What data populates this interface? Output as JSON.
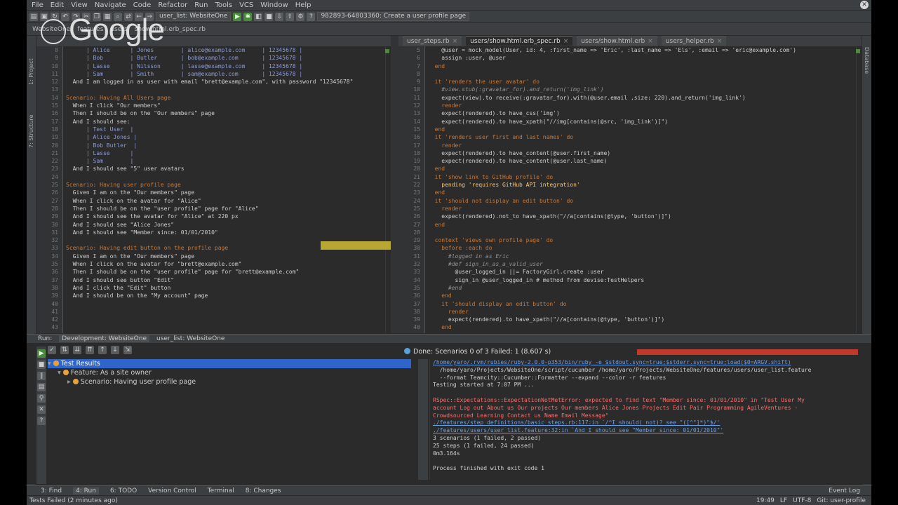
{
  "menu": [
    "File",
    "Edit",
    "View",
    "Navigate",
    "Code",
    "Refactor",
    "Run",
    "Tools",
    "VCS",
    "Window",
    "Help"
  ],
  "toolbar": {
    "run_config": "user_list: WebsiteOne",
    "branch_combo": "982893-64803360: Create a user profile page"
  },
  "navbar": [
    "WebsiteOne",
    "features",
    "users",
    "show.html.erb_spec.rb"
  ],
  "watermark": "Google",
  "left_strip": [
    "1: Project",
    "7: Structure"
  ],
  "right_strip": [
    "Database"
  ],
  "left_editor": {
    "gutter": [
      "8",
      "9",
      "10",
      "11",
      "12",
      "13",
      "14",
      "15",
      "16",
      "17",
      "18",
      "19",
      "20",
      "21",
      "22",
      "23",
      "24",
      "25",
      "26",
      "27",
      "28",
      "29",
      "30",
      "31",
      "32",
      "33",
      "34",
      "35",
      "36",
      "37",
      "38",
      "39",
      "40",
      "41",
      "42",
      "43"
    ],
    "lines": [
      {
        "t": "      | Alice      | Jones        | alice@example.com     | 12345678 |",
        "c": "str"
      },
      {
        "t": "      | Bob        | Butler       | bob@example.com       | 12345678 |",
        "c": "str"
      },
      {
        "t": "      | Lasse      | Nilsson      | lasse@example.com     | 12345678 |",
        "c": "str"
      },
      {
        "t": "      | Sam        | Smith        | sam@example.com       | 12345678 |",
        "c": "str"
      },
      {
        "t": "  And I am logged in as user with email \"brett@example.com\", with password \"12345678\"",
        "c": ""
      },
      {
        "t": "",
        "c": ""
      },
      {
        "t": "Scenario: Having All Users page",
        "c": "kw"
      },
      {
        "t": "  When I click \"Our members\"",
        "c": ""
      },
      {
        "t": "  Then I should be on the \"Our members\" page",
        "c": ""
      },
      {
        "t": "  And I should see:",
        "c": ""
      },
      {
        "t": "      | Test User  |",
        "c": "str"
      },
      {
        "t": "      | Alice Jones |",
        "c": "str"
      },
      {
        "t": "      | Bob Butler  |",
        "c": "str"
      },
      {
        "t": "      | Lasse      |",
        "c": "str"
      },
      {
        "t": "      | Sam        |",
        "c": "str"
      },
      {
        "t": "  And I should see \"5\" user avatars",
        "c": ""
      },
      {
        "t": "",
        "c": ""
      },
      {
        "t": "Scenario: Having user profile page",
        "c": "kw"
      },
      {
        "t": "  Given I am on the \"Our members\" page",
        "c": ""
      },
      {
        "t": "  When I click on the avatar for \"Alice\"",
        "c": ""
      },
      {
        "t": "  Then I should be on the \"user profile\" page for \"Alice\"",
        "c": ""
      },
      {
        "t": "  And I should see the avatar for \"Alice\" at 220 px",
        "c": ""
      },
      {
        "t": "  And I should see \"Alice Jones\"",
        "c": ""
      },
      {
        "t": "  And I should see \"Member since: 01/01/2010\"",
        "c": ""
      },
      {
        "t": "",
        "c": ""
      },
      {
        "t": "Scenario: Having edit button on the profile page",
        "c": "kw"
      },
      {
        "t": "  Given I am on the \"Our members\" page",
        "c": ""
      },
      {
        "t": "  When I click on the avatar for \"brett@example.com\"",
        "c": ""
      },
      {
        "t": "  Then I should be on the \"user profile\" page for \"brett@example.com\"",
        "c": ""
      },
      {
        "t": "  And I should see button \"Edit\"",
        "c": ""
      },
      {
        "t": "  And I click the \"Edit\" button",
        "c": ""
      },
      {
        "t": "  And I should be on the \"My account\" page",
        "c": ""
      }
    ]
  },
  "right_editor": {
    "tabs": [
      "user_steps.rb",
      "users/show.html.erb_spec.rb",
      "users/show.html.erb",
      "users_helper.rb"
    ],
    "active_tab": 1,
    "gutter": [
      "5",
      "6",
      "7",
      "8",
      "9",
      "10",
      "11",
      "12",
      "13",
      "14",
      "15",
      "16",
      "17",
      "18",
      "19",
      "20",
      "21",
      "22",
      "23",
      "24",
      "25",
      "26",
      "27",
      "28",
      "29",
      "30",
      "31",
      "32",
      "33",
      "34",
      "35",
      "36",
      "37",
      "38",
      "39",
      "40"
    ],
    "lines": [
      {
        "t": "    @user = mock_model(User, id: 4, :first_name => 'Eric', :last_name => 'Els', :email => 'eric@example.com')",
        "c": ""
      },
      {
        "t": "    assign :user, @user",
        "c": ""
      },
      {
        "t": "  end",
        "c": "kw"
      },
      {
        "t": "",
        "c": ""
      },
      {
        "t": "  it 'renders the user avatar' do",
        "c": "kw"
      },
      {
        "t": "    #view.stub(:gravatar_for).and_return('img_link')",
        "c": "com"
      },
      {
        "t": "    expect(view).to receive(:gravatar_for).with(@user.email ,size: 220).and_return('img_link')",
        "c": ""
      },
      {
        "t": "    render",
        "c": "kw"
      },
      {
        "t": "    expect(rendered).to have_css('img')",
        "c": ""
      },
      {
        "t": "    expect(rendered).to have_xpath(\"//img[contains(@src, 'img_link')]\")",
        "c": ""
      },
      {
        "t": "  end",
        "c": "kw"
      },
      {
        "t": "  it 'renders user first and last names' do",
        "c": "kw"
      },
      {
        "t": "    render",
        "c": "kw"
      },
      {
        "t": "    expect(rendered).to have_content(@user.first_name)",
        "c": ""
      },
      {
        "t": "    expect(rendered).to have_content(@user.last_name)",
        "c": ""
      },
      {
        "t": "  end",
        "c": "kw"
      },
      {
        "t": "  it 'show link to GitHub profile' do",
        "c": "kw"
      },
      {
        "t": "    pending 'requires GitHub API integration'",
        "c": "hl"
      },
      {
        "t": "  end",
        "c": "kw"
      },
      {
        "t": "  it 'should not display an edit button' do",
        "c": "kw"
      },
      {
        "t": "    render",
        "c": "kw"
      },
      {
        "t": "    expect(rendered).not_to have_xpath(\"//a[contains(@type, 'button')]\")",
        "c": ""
      },
      {
        "t": "  end",
        "c": "kw"
      },
      {
        "t": "",
        "c": ""
      },
      {
        "t": "  context 'views own profile page' do",
        "c": "kw"
      },
      {
        "t": "    before :each do",
        "c": "kw"
      },
      {
        "t": "      #logged in as Eric",
        "c": "com"
      },
      {
        "t": "      #def sign_in_as_a_valid_user",
        "c": "com"
      },
      {
        "t": "        @user_logged_in ||= FactoryGirl.create :user",
        "c": ""
      },
      {
        "t": "        sign_in @user_logged_in # method from devise:TestHelpers",
        "c": ""
      },
      {
        "t": "      #end",
        "c": "com"
      },
      {
        "t": "    end",
        "c": "kw"
      },
      {
        "t": "    it 'should display an edit button' do",
        "c": "kw"
      },
      {
        "t": "      render",
        "c": "kw"
      },
      {
        "t": "      expect(rendered).to have_xpath(\"//a[contains(@type, 'button')]\")",
        "c": ""
      },
      {
        "t": "    end",
        "c": "kw"
      }
    ]
  },
  "run_toolbar": {
    "label": "Run:",
    "tabs": [
      "Development: WebsiteOne",
      "user_list: WebsiteOne"
    ]
  },
  "run_panel": {
    "status": "Done: Scenarios 0 of 3 Failed: 1 (8.607 s)",
    "progress": 1.0,
    "tree": [
      {
        "label": "Test Results",
        "indent": 0,
        "sel": true
      },
      {
        "label": "Feature: As a site owner",
        "indent": 1,
        "sel": false
      },
      {
        "label": "Scenario: Having user profile page",
        "indent": 2,
        "sel": false
      }
    ],
    "console": [
      {
        "t": "/home/yaro/.rvm/rubies/ruby-2.0.0-p353/bin/ruby -e $stdout.sync=true;$stderr.sync=true;load($0=ARGV.shift)",
        "c": "link"
      },
      {
        "t": "  /home/yaro/Projects/WebsiteOne/script/cucumber /home/yaro/Projects/WebsiteOne/features/users/user_list.feature",
        "c": "ok"
      },
      {
        "t": "  --format Teamcity::Cucumber::Formatter --expand --color -r features",
        "c": "ok"
      },
      {
        "t": "Testing started at 7:07 PM ...",
        "c": "ok"
      },
      {
        "t": "",
        "c": "ok"
      },
      {
        "t": "RSpec::Expectations::ExpectationNotMetError: expected to find text \"Member since: 01/01/2010\" in \"Test User My",
        "c": "err"
      },
      {
        "t": "account Log out About us Our projects Our members Alice Jones Projects Edit Pair Programming AgileVentures -",
        "c": "err"
      },
      {
        "t": "Crowdsourced Learning Contact us Name Email Message\"",
        "c": "err"
      },
      {
        "t": "./features/step_definitions/basic_steps.rb:117:in `/^I should( not)? see \"([^\"]*)\"$/'",
        "c": "link"
      },
      {
        "t": "./features/users/user_list.feature:32:in `And I should see \"Member since: 01/01/2010\"'",
        "c": "link"
      },
      {
        "t": "3 scenarios (1 failed, 2 passed)",
        "c": "ok"
      },
      {
        "t": "25 steps (1 failed, 24 passed)",
        "c": "ok"
      },
      {
        "t": "0m3.164s",
        "c": "ok"
      },
      {
        "t": "",
        "c": "ok"
      },
      {
        "t": "Process finished with exit code 1",
        "c": "ok"
      }
    ]
  },
  "bottom_tabs": [
    "3: Find",
    "4: Run",
    "6: TODO",
    "Version Control",
    "Terminal",
    "8: Changes"
  ],
  "bottom_active": "4: Run",
  "event_log": "Event Log",
  "status": {
    "message": "Tests Failed (2 minutes ago)",
    "position": "19:49",
    "line_sep": "LF",
    "encoding": "UTF-8",
    "vcs": "Git: user-profile"
  }
}
